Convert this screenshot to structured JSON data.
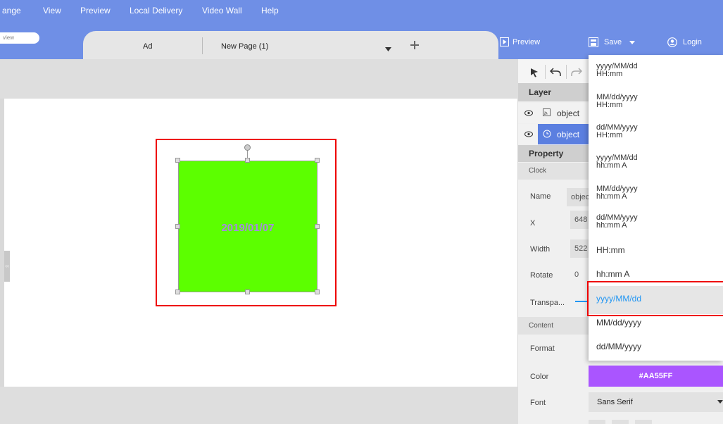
{
  "menu": [
    "ange",
    "View",
    "Preview",
    "Local Delivery",
    "Video Wall",
    "Help"
  ],
  "tabs": {
    "pill_text": "view",
    "page1": "Ad",
    "page2": "New Page (1)",
    "dropdown_icon": "caret-down-icon",
    "add_icon": "plus-icon"
  },
  "toolbar": {
    "preview": "Preview",
    "save": "Save",
    "login": "Login"
  },
  "canvas": {
    "clock_text": "2019/01/07",
    "clock_bg": "#5cff00",
    "clock_text_color": "#a78be0",
    "collapse_handle": "‹‹"
  },
  "layer": {
    "header": "Layer",
    "items": [
      {
        "label": "object",
        "icon": "rss-icon",
        "selected": false
      },
      {
        "label": "object",
        "icon": "clock-icon",
        "selected": true
      }
    ]
  },
  "property": {
    "header": "Property",
    "section": "Clock",
    "name_label": "Name",
    "name_value": "objec",
    "x_label": "X",
    "x_value": "648",
    "width_label": "Width",
    "width_value": "522",
    "rotate_label": "Rotate",
    "rotate_value": "0",
    "transparency_label": "Transpa..."
  },
  "content": {
    "header": "Content",
    "format_label": "Format",
    "color_label": "Color",
    "color_value": "#AA55FF",
    "font_label": "Font",
    "font_value": "Sans Serif"
  },
  "format_dropdown": {
    "items": [
      [
        "yyyy/MM/dd",
        "HH:mm"
      ],
      [
        "MM/dd/yyyy",
        "HH:mm"
      ],
      [
        "dd/MM/yyyy",
        "HH:mm"
      ],
      [
        "yyyy/MM/dd",
        "hh:mm A"
      ],
      [
        "MM/dd/yyyy",
        "hh:mm A"
      ],
      [
        "dd/MM/yyyy",
        "hh:mm A"
      ],
      [
        "HH:mm"
      ],
      [
        "hh:mm A"
      ],
      [
        "yyyy/MM/dd"
      ],
      [
        "MM/dd/yyyy"
      ],
      [
        "dd/MM/yyyy"
      ]
    ],
    "selected_index": 8
  },
  "colors": {
    "menubar": "#6f8fe6",
    "selection": "#ee0000",
    "layer_selected": "#5b7fe0"
  }
}
